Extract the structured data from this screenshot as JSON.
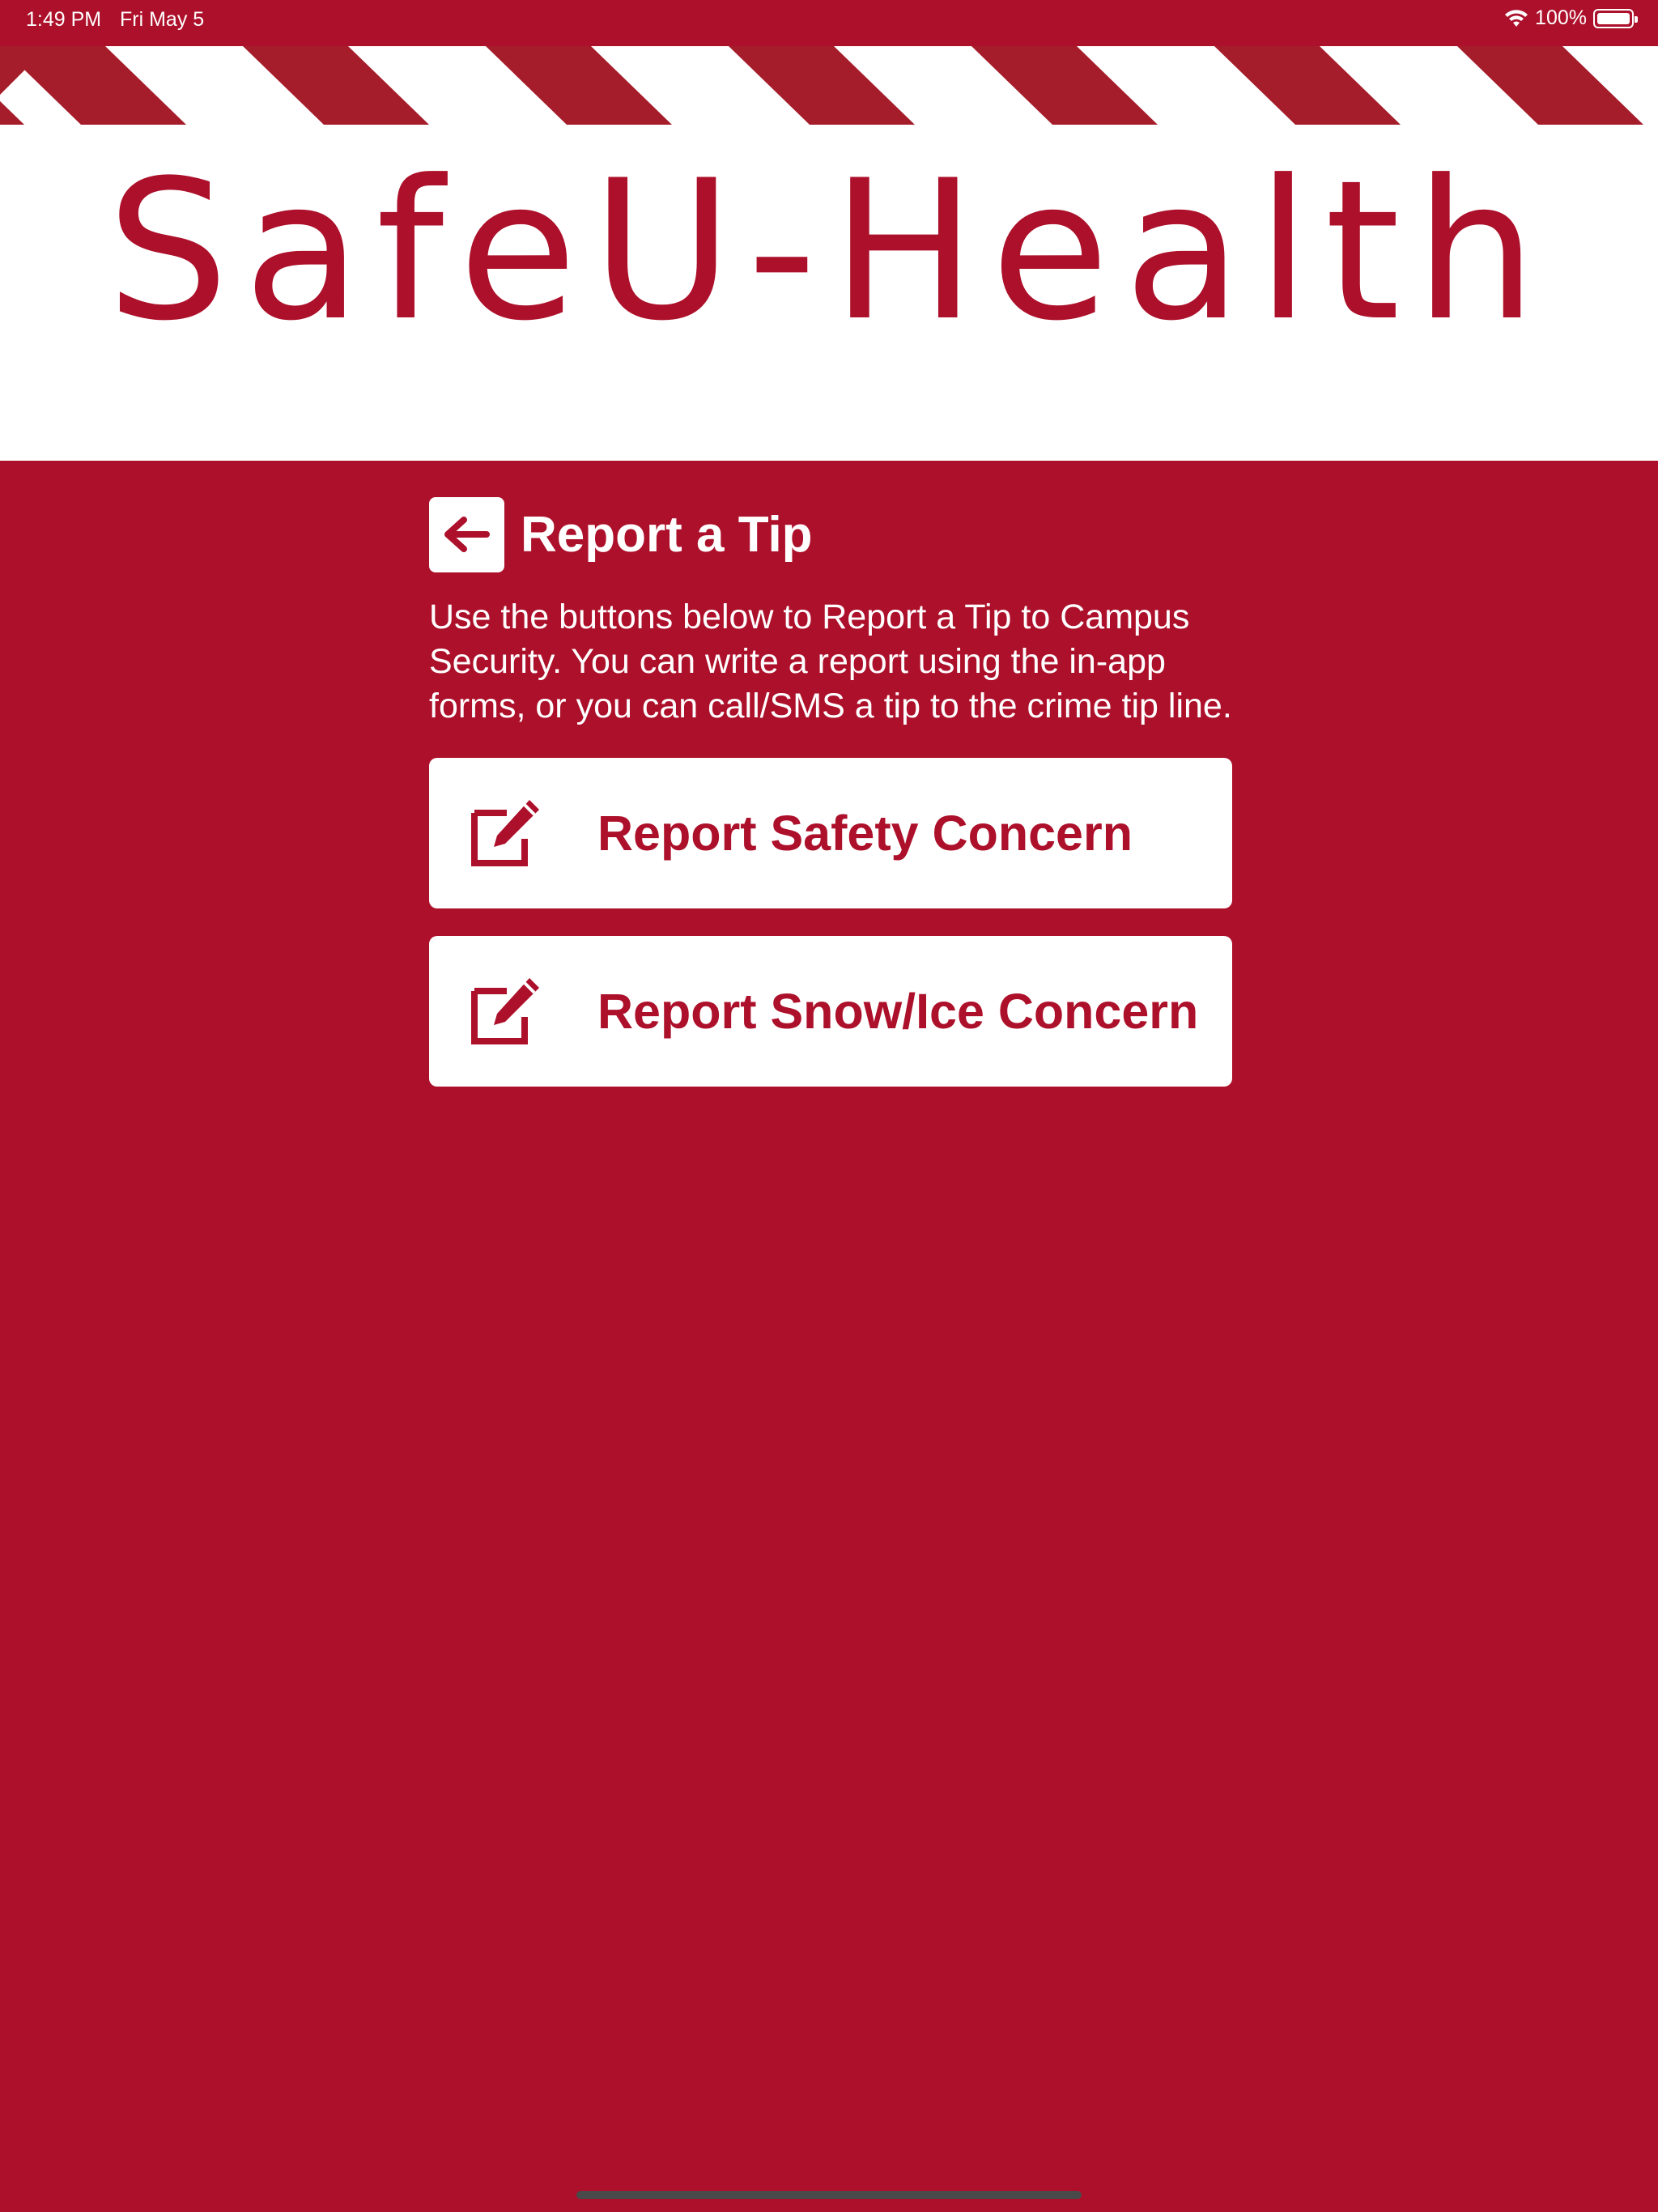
{
  "status_bar": {
    "time": "1:49 PM",
    "date": "Fri May 5",
    "battery_percent": "100%",
    "battery_level": 1.0
  },
  "banner": {
    "logo_text": "SafeU-Health"
  },
  "page": {
    "title": "Report a Tip",
    "description": "Use the buttons below to Report a Tip to Campus Security. You can write a report using the in-app forms, or you can call/SMS a tip to the crime tip line.",
    "back_icon": "arrow-left-icon"
  },
  "actions": [
    {
      "label": "Report Safety Concern",
      "icon": "edit-icon"
    },
    {
      "label": "Report Snow/Ice Concern",
      "icon": "edit-icon"
    }
  ],
  "colors": {
    "brand": "#AD102A",
    "stripe": "#A51D2B",
    "white": "#FFFFFF"
  }
}
